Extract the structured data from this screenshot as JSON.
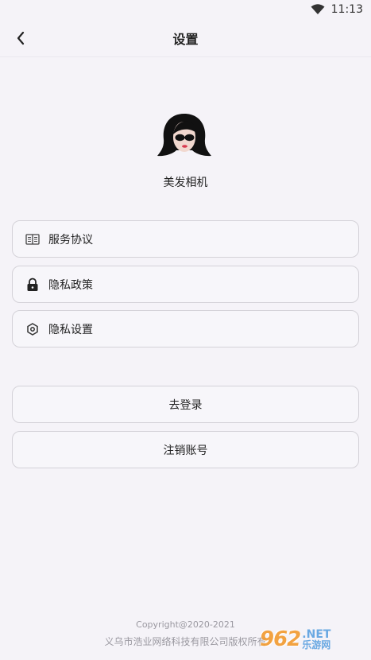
{
  "status": {
    "time": "11:13",
    "wifi_icon": "wifi-icon"
  },
  "header": {
    "title": "设置",
    "back_icon": "chevron-left-icon"
  },
  "app": {
    "name": "美发相机",
    "avatar_icon": "woman-sunglasses-avatar"
  },
  "menu": [
    {
      "label": "服务协议",
      "icon": "book-icon"
    },
    {
      "label": "隐私政策",
      "icon": "lock-icon"
    },
    {
      "label": "隐私设置",
      "icon": "hexagon-settings-icon"
    }
  ],
  "actions": {
    "login_label": "去登录",
    "delete_account_label": "注销账号"
  },
  "footer": {
    "copyright": "Copyright@2020-2021",
    "company": "义乌市浩业网络科技有限公司版权所有"
  },
  "watermark": {
    "number": "962",
    "net": ".NET",
    "cn": "乐游网"
  },
  "colors": {
    "background": "#f5f3f8",
    "border": "#d4d2d8",
    "footer_text": "#9a98a0"
  }
}
